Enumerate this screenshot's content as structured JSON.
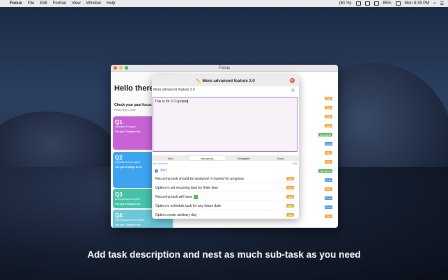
{
  "menubar": {
    "app_name": "Focus",
    "items": [
      "File",
      "Edit",
      "Format",
      "View",
      "Window",
      "Help"
    ],
    "battery_percent": "85%",
    "clock": "Mon 8:39 PM",
    "temp": "(61 %)"
  },
  "window": {
    "title": "Focus",
    "greeting": "Hello there,",
    "check_label": "Check your past focus",
    "date": "Friday, May 1, 2020",
    "quadrants": [
      {
        "label": "Q1",
        "subtitle": "Important & Urgent",
        "count_text": "You got 2 things to do"
      },
      {
        "label": "Q2",
        "subtitle": "Important & Not Urgent",
        "count_text": "You got 13 things to do"
      },
      {
        "label": "Q3",
        "subtitle": "Not Important & Urgent",
        "count_text": "You got 8 things to do"
      },
      {
        "label": "Q4",
        "subtitle": "Not Important & Not Urgent",
        "count_text": "You got 7 things to do"
      }
    ],
    "right_tags": [
      "Todo",
      "Todo",
      "Todo",
      "Todo",
      "Inprogress",
      "Done",
      "Todo",
      "Todo",
      "Inprogress",
      "Done",
      "Todo",
      "Done",
      "Done",
      "Todo"
    ]
  },
  "modal": {
    "header": "✏️ More advanced feature 2.0",
    "title_value": "More advanced feature 2.0",
    "description": "This is for 2.0 update",
    "segments": [
      "Todo",
      "Inprogress",
      "Delegated",
      "Done"
    ],
    "selected_segment": "Inprogress",
    "sub_header": "Add sub items",
    "edit_label": "Edit",
    "add_label": "Add",
    "subtasks": [
      {
        "text": "Recurring task should be analyzed n charted for progress",
        "status": "Todo"
      },
      {
        "text": "Option to set recurring task for finite time",
        "status": "Todo"
      },
      {
        "text": "Recurring task will have",
        "status": "Todo",
        "check": true
      },
      {
        "text": "Option to schedule task for any future date",
        "status": "Todo"
      },
      {
        "text": "Option create arbitrary day",
        "status": "Todo"
      }
    ]
  },
  "caption": "Add task description and nest as much sub-task as you need",
  "colors": {
    "q1": "#c863d6",
    "q2": "#3ea4ef",
    "q3": "#45c2a8",
    "q4": "#6cc7d8",
    "todo": "#f1a63a",
    "inprogress": "#5bb45a",
    "done": "#4a93d9",
    "accent": "#b873d6"
  }
}
